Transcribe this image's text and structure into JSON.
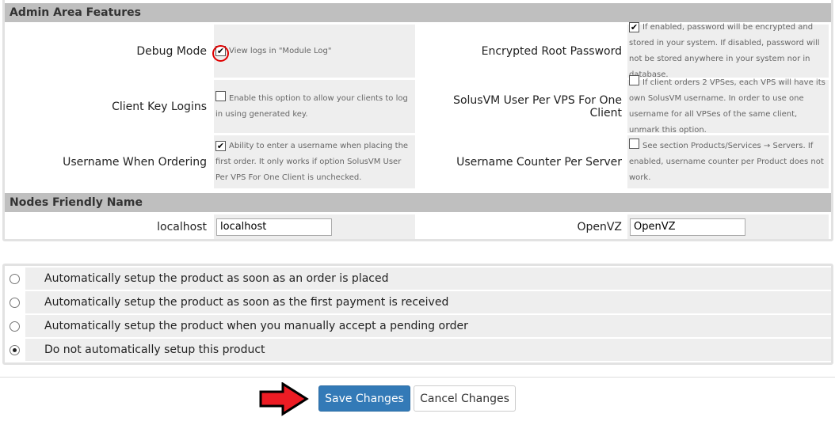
{
  "admin_section": {
    "title": "Admin Area Features",
    "rows": [
      {
        "left_label": "Debug Mode",
        "left_checked": true,
        "left_desc": "View logs in \"Module Log\"",
        "right_label": "Encrypted Root Password",
        "right_checked": true,
        "right_desc": "If enabled, password will be encrypted and stored in your system. If disabled, password will not be stored anywhere in your system nor in database."
      },
      {
        "left_label": "Client Key Logins",
        "left_checked": false,
        "left_desc": "Enable this option to allow your clients to log in using generated key.",
        "right_label": "SolusVM User Per VPS For One Client",
        "right_checked": false,
        "right_desc": "If client orders 2 VPSes, each VPS will have its own SolusVM username. In order to use one username for all VPSes of the same client, unmark this option."
      },
      {
        "left_label": "Username When Ordering",
        "left_checked": true,
        "left_desc": "Ability to enter a username when placing the first order. It only works if option SolusVM User Per VPS For One Client is unchecked.",
        "right_label": "Username Counter Per Server",
        "right_checked": false,
        "right_desc": "See section Products/Services → Servers. If enabled, username counter per Product does not work."
      }
    ]
  },
  "nodes_section": {
    "title": "Nodes Friendly Name",
    "left_label": "localhost",
    "left_value": "localhost",
    "right_label": "OpenVZ",
    "right_value": "OpenVZ"
  },
  "setup_options": [
    {
      "label": "Automatically setup the product as soon as an order is placed",
      "selected": false
    },
    {
      "label": "Automatically setup the product as soon as the first payment is received",
      "selected": false
    },
    {
      "label": "Automatically setup the product when you manually accept a pending order",
      "selected": false
    },
    {
      "label": "Do not automatically setup this product",
      "selected": true
    }
  ],
  "buttons": {
    "save": "Save Changes",
    "cancel": "Cancel Changes"
  },
  "colors": {
    "primary": "#337ab7",
    "arrow": "#ed1c24",
    "highlight_circle": "#e00000"
  }
}
